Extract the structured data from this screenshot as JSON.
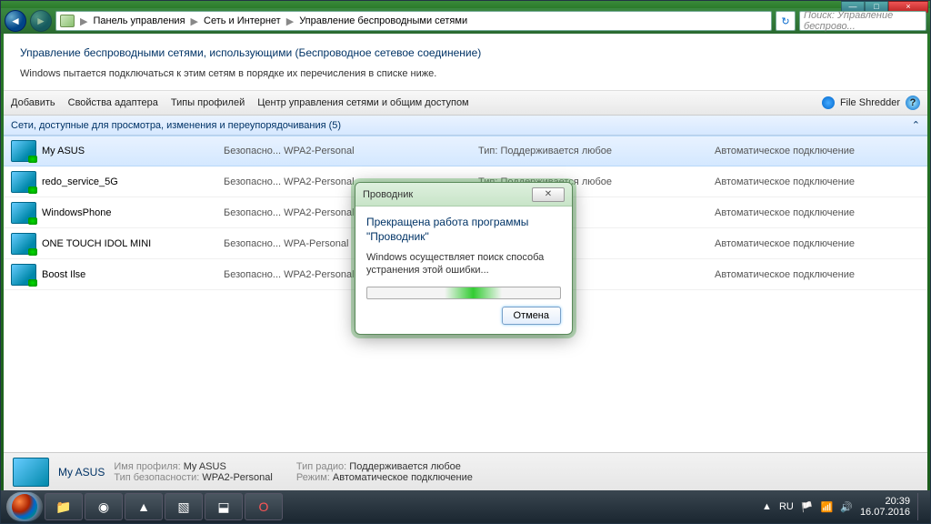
{
  "window_controls": {
    "min": "—",
    "max": "□",
    "close": "×"
  },
  "breadcrumb": {
    "root": "Панель управления",
    "mid": "Сеть и Интернет",
    "leaf": "Управление беспроводными сетями"
  },
  "search_placeholder": "Поиск: Управление беспрово...",
  "heading": "Управление беспроводными сетями, использующими (Беспроводное сетевое соединение)",
  "subtext": "Windows пытается подключаться к этим сетям в порядке их перечисления в списке ниже.",
  "toolbar": {
    "add": "Добавить",
    "adapter": "Свойства адаптера",
    "profiles": "Типы профилей",
    "center": "Центр управления сетями и общим доступом",
    "shredder": "File Shredder"
  },
  "banner": "Сети, доступные для просмотра, изменения и переупорядочивания (5)",
  "networks": [
    {
      "name": "My ASUS",
      "security": "Безопасно...  WPA2-Personal",
      "type": "Тип: Поддерживается любое",
      "conn": "Автоматическое подключение"
    },
    {
      "name": "redo_service_5G",
      "security": "Безопасно...  WPA2-Personal",
      "type": "Тип: Поддерживается любое",
      "conn": "Автоматическое подключение"
    },
    {
      "name": "WindowsPhone",
      "security": "Безопасно...  WPA2-Personal",
      "type": "бое",
      "conn": "Автоматическое подключение"
    },
    {
      "name": "ONE TOUCH IDOL MINI",
      "security": "Безопасно...  WPA-Personal",
      "type": "бое",
      "conn": "Автоматическое подключение"
    },
    {
      "name": "Boost Ilse",
      "security": "Безопасно...  WPA2-Personal",
      "type": "бое",
      "conn": "Автоматическое подключение"
    }
  ],
  "details": {
    "title": "My ASUS",
    "profile_label": "Имя профиля:",
    "profile": "My ASUS",
    "sectype_label": "Тип безопасности:",
    "sectype": "WPA2-Personal",
    "radio_label": "Тип радио:",
    "radio": "Поддерживается любое",
    "mode_label": "Режим:",
    "mode": "Автоматическое подключение"
  },
  "dialog": {
    "title": "Проводник",
    "heading": "Прекращена работа программы \"Проводник\"",
    "body": "Windows осуществляет поиск способа устранения этой ошибки...",
    "cancel": "Отмена"
  },
  "tray": {
    "lang": "RU",
    "time": "20:39",
    "date": "16.07.2016"
  }
}
